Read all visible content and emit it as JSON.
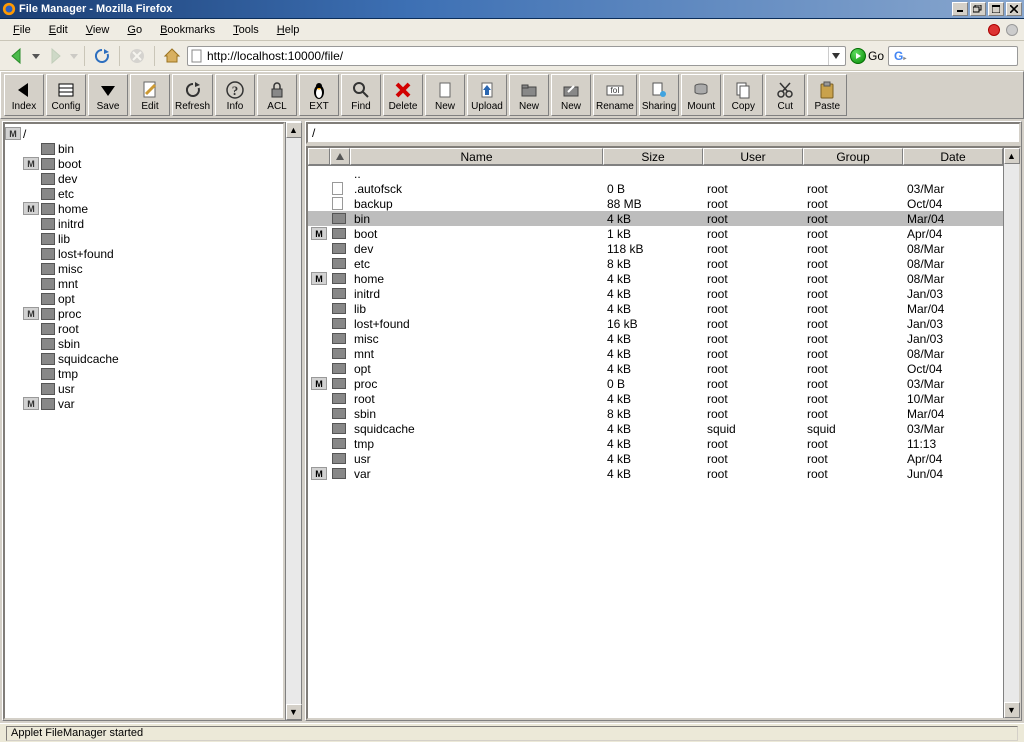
{
  "window": {
    "title": "File Manager - Mozilla Firefox",
    "status": "Applet FileManager started"
  },
  "browser": {
    "menus": [
      "File",
      "Edit",
      "View",
      "Go",
      "Bookmarks",
      "Tools",
      "Help"
    ],
    "url": "http://localhost:10000/file/",
    "go_label": "Go",
    "search_placeholder": ""
  },
  "toolbar": [
    {
      "id": "index",
      "label": "Index",
      "icon": "arrow-left-black"
    },
    {
      "id": "config",
      "label": "Config",
      "icon": "config"
    },
    {
      "id": "save",
      "label": "Save",
      "icon": "arrow-down-black"
    },
    {
      "id": "edit",
      "label": "Edit",
      "icon": "edit"
    },
    {
      "id": "refresh",
      "label": "Refresh",
      "icon": "refresh"
    },
    {
      "id": "info",
      "label": "Info",
      "icon": "info"
    },
    {
      "id": "acl",
      "label": "ACL",
      "icon": "lock"
    },
    {
      "id": "ext",
      "label": "EXT",
      "icon": "penguin"
    },
    {
      "id": "find",
      "label": "Find",
      "icon": "magnify"
    },
    {
      "id": "delete",
      "label": "Delete",
      "icon": "x-red"
    },
    {
      "id": "new1",
      "label": "New",
      "icon": "doc"
    },
    {
      "id": "upload",
      "label": "Upload",
      "icon": "upload"
    },
    {
      "id": "new2",
      "label": "New",
      "icon": "folder"
    },
    {
      "id": "new3",
      "label": "New",
      "icon": "link"
    },
    {
      "id": "rename",
      "label": "Rename",
      "icon": "rename"
    },
    {
      "id": "sharing",
      "label": "Sharing",
      "icon": "share"
    },
    {
      "id": "mount",
      "label": "Mount",
      "icon": "mount"
    },
    {
      "id": "copy",
      "label": "Copy",
      "icon": "copy"
    },
    {
      "id": "cut",
      "label": "Cut",
      "icon": "cut"
    },
    {
      "id": "paste",
      "label": "Paste",
      "icon": "paste"
    }
  ],
  "tree": {
    "root": {
      "name": "/",
      "marked": true
    },
    "items": [
      {
        "name": "bin",
        "marked": false
      },
      {
        "name": "boot",
        "marked": true
      },
      {
        "name": "dev",
        "marked": false
      },
      {
        "name": "etc",
        "marked": false
      },
      {
        "name": "home",
        "marked": true
      },
      {
        "name": "initrd",
        "marked": false
      },
      {
        "name": "lib",
        "marked": false
      },
      {
        "name": "lost+found",
        "marked": false
      },
      {
        "name": "misc",
        "marked": false
      },
      {
        "name": "mnt",
        "marked": false
      },
      {
        "name": "opt",
        "marked": false
      },
      {
        "name": "proc",
        "marked": true
      },
      {
        "name": "root",
        "marked": false
      },
      {
        "name": "sbin",
        "marked": false
      },
      {
        "name": "squidcache",
        "marked": false
      },
      {
        "name": "tmp",
        "marked": false
      },
      {
        "name": "usr",
        "marked": false
      },
      {
        "name": "var",
        "marked": true
      }
    ]
  },
  "listing": {
    "path": "/",
    "columns": [
      "",
      "",
      "Name",
      "Size",
      "User",
      "Group",
      "Date"
    ],
    "rows": [
      {
        "marked": false,
        "type": "up",
        "name": "..",
        "size": "",
        "user": "",
        "group": "",
        "date": "",
        "selected": false
      },
      {
        "marked": false,
        "type": "file",
        "name": ".autofsck",
        "size": "0 B",
        "user": "root",
        "group": "root",
        "date": "03/Mar",
        "selected": false
      },
      {
        "marked": false,
        "type": "file",
        "name": "backup",
        "size": "88 MB",
        "user": "root",
        "group": "root",
        "date": "Oct/04",
        "selected": false
      },
      {
        "marked": false,
        "type": "dir",
        "name": "bin",
        "size": "4 kB",
        "user": "root",
        "group": "root",
        "date": "Mar/04",
        "selected": true
      },
      {
        "marked": true,
        "type": "dir",
        "name": "boot",
        "size": "1 kB",
        "user": "root",
        "group": "root",
        "date": "Apr/04",
        "selected": false
      },
      {
        "marked": false,
        "type": "dir",
        "name": "dev",
        "size": "118 kB",
        "user": "root",
        "group": "root",
        "date": "08/Mar",
        "selected": false
      },
      {
        "marked": false,
        "type": "dir",
        "name": "etc",
        "size": "8 kB",
        "user": "root",
        "group": "root",
        "date": "08/Mar",
        "selected": false
      },
      {
        "marked": true,
        "type": "dir",
        "name": "home",
        "size": "4 kB",
        "user": "root",
        "group": "root",
        "date": "08/Mar",
        "selected": false
      },
      {
        "marked": false,
        "type": "dir",
        "name": "initrd",
        "size": "4 kB",
        "user": "root",
        "group": "root",
        "date": "Jan/03",
        "selected": false
      },
      {
        "marked": false,
        "type": "dir",
        "name": "lib",
        "size": "4 kB",
        "user": "root",
        "group": "root",
        "date": "Mar/04",
        "selected": false
      },
      {
        "marked": false,
        "type": "dir",
        "name": "lost+found",
        "size": "16 kB",
        "user": "root",
        "group": "root",
        "date": "Jan/03",
        "selected": false
      },
      {
        "marked": false,
        "type": "dir",
        "name": "misc",
        "size": "4 kB",
        "user": "root",
        "group": "root",
        "date": "Jan/03",
        "selected": false
      },
      {
        "marked": false,
        "type": "dir",
        "name": "mnt",
        "size": "4 kB",
        "user": "root",
        "group": "root",
        "date": "08/Mar",
        "selected": false
      },
      {
        "marked": false,
        "type": "dir",
        "name": "opt",
        "size": "4 kB",
        "user": "root",
        "group": "root",
        "date": "Oct/04",
        "selected": false
      },
      {
        "marked": true,
        "type": "dir",
        "name": "proc",
        "size": "0 B",
        "user": "root",
        "group": "root",
        "date": "03/Mar",
        "selected": false
      },
      {
        "marked": false,
        "type": "dir",
        "name": "root",
        "size": "4 kB",
        "user": "root",
        "group": "root",
        "date": "10/Mar",
        "selected": false
      },
      {
        "marked": false,
        "type": "dir",
        "name": "sbin",
        "size": "8 kB",
        "user": "root",
        "group": "root",
        "date": "Mar/04",
        "selected": false
      },
      {
        "marked": false,
        "type": "dir",
        "name": "squidcache",
        "size": "4 kB",
        "user": "squid",
        "group": "squid",
        "date": "03/Mar",
        "selected": false
      },
      {
        "marked": false,
        "type": "dir",
        "name": "tmp",
        "size": "4 kB",
        "user": "root",
        "group": "root",
        "date": "11:13",
        "selected": false
      },
      {
        "marked": false,
        "type": "dir",
        "name": "usr",
        "size": "4 kB",
        "user": "root",
        "group": "root",
        "date": "Apr/04",
        "selected": false
      },
      {
        "marked": true,
        "type": "dir",
        "name": "var",
        "size": "4 kB",
        "user": "root",
        "group": "root",
        "date": "Jun/04",
        "selected": false
      }
    ]
  },
  "mark_glyph": "M"
}
